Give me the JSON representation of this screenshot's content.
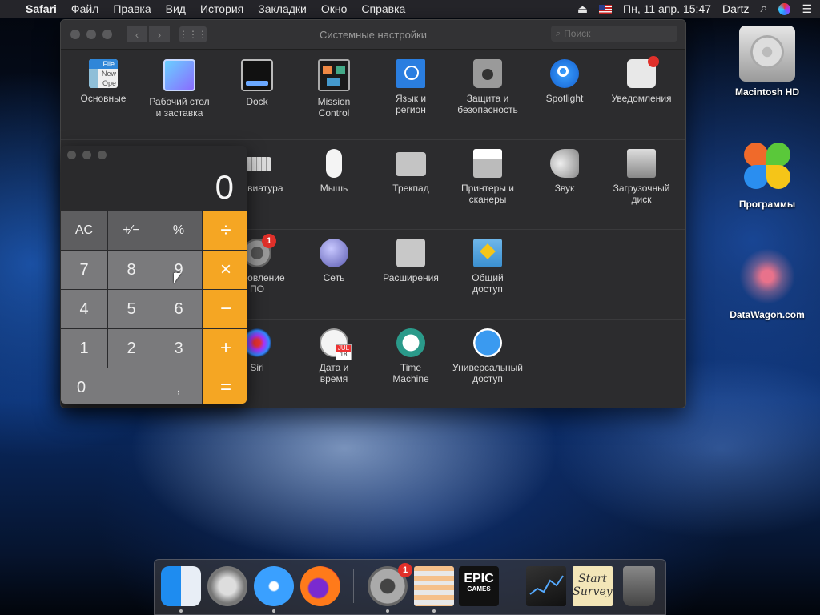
{
  "menubar": {
    "apple": "",
    "app": "Safari",
    "items": [
      "Файл",
      "Правка",
      "Вид",
      "История",
      "Закладки",
      "Окно",
      "Справка"
    ],
    "eject": "⏏",
    "datetime": "Пн, 11 апр.  15:47",
    "user": "Dartz",
    "search_icon": "⌕",
    "list_icon": "☰"
  },
  "prefs": {
    "title": "Системные настройки",
    "search_placeholder": "Поиск",
    "back": "‹",
    "forward": "›",
    "grid": "⋮⋮⋮",
    "row1": [
      "Основные",
      "Рабочий стол\nи заставка",
      "Dock",
      "Mission\nControl",
      "Язык и\nрегион",
      "Защита и\nбезопасность",
      "Spotlight",
      "Уведомления"
    ],
    "row2": [
      "Клавиатура",
      "Мышь",
      "Трекпад",
      "Принтеры и\nсканеры",
      "Звук",
      "Загрузочный\nдиск"
    ],
    "row3": [
      "Обновление\nПО",
      "Сеть",
      "Расширения",
      "Общий\nдоступ"
    ],
    "row4": [
      "Siri",
      "Дата и\nвремя",
      "Time\nMachine",
      "Универсальный\nдоступ"
    ],
    "general_icon_text": [
      "File",
      "New",
      "Ope"
    ],
    "update_badge": "1",
    "calendar_month": "JUL",
    "calendar_day": "18"
  },
  "calculator": {
    "display": "0",
    "keys": [
      "AC",
      "+∕−",
      "%",
      "÷",
      "7",
      "8",
      "9",
      "×",
      "4",
      "5",
      "6",
      "−",
      "1",
      "2",
      "3",
      "+",
      "0",
      ",",
      "="
    ]
  },
  "desktop": {
    "icons": [
      "Macintosh HD",
      "Программы",
      "DataWagon.com"
    ]
  },
  "dock": {
    "update_badge": "1",
    "epic_line1": "EPIC",
    "epic_line2": "GAMES",
    "survey_line1": "Start",
    "survey_line2": "Survey"
  },
  "colors": {
    "accent_orange": "#f5a623",
    "badge_red": "#e0302a"
  }
}
